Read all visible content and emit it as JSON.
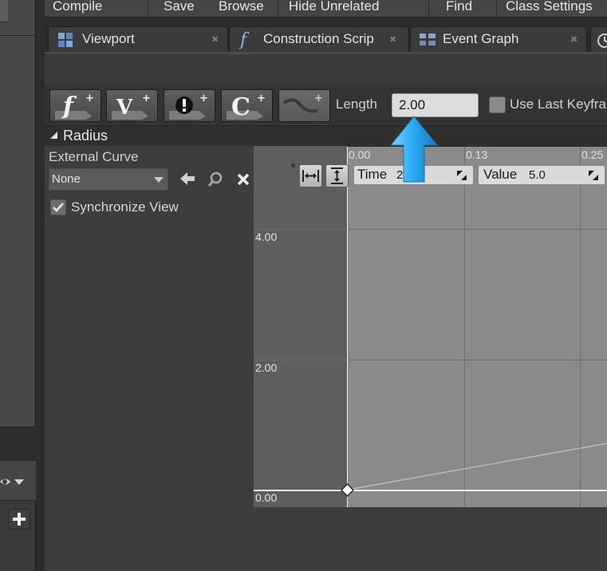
{
  "toolbar": {
    "compile": "Compile",
    "save": "Save",
    "browse": "Browse",
    "hide_unrelated": "Hide Unrelated",
    "find": "Find",
    "class_settings": "Class Settings"
  },
  "tabs": [
    {
      "label": "Viewport",
      "icon": "viewport-icon"
    },
    {
      "label": "Construction Scrip",
      "icon": "function-icon"
    },
    {
      "label": "Event Graph",
      "icon": "graph-icon"
    }
  ],
  "timeline_toolbar": {
    "buttons": [
      "add-float-track-icon",
      "add-vector-track-icon",
      "add-event-track-icon",
      "add-color-track-icon",
      "add-curve-asset-icon"
    ],
    "length_label": "Length",
    "length_value": "2.00",
    "use_last_keyframe_label": "Use Last Keyfra",
    "use_last_keyframe_checked": false
  },
  "track": {
    "name": "Radius",
    "external_curve_label": "External Curve",
    "external_curve_value": "None",
    "synchronize_view_label": "Synchronize View",
    "synchronize_view_checked": true
  },
  "curve_editor": {
    "time_label": "Time",
    "time_value": "2",
    "value_label": "Value",
    "value_value": "5.0",
    "x_ticks": [
      "0.00",
      "0.13",
      "0.25"
    ],
    "y_ticks": [
      "4.00",
      "2.00",
      "0.00"
    ]
  },
  "annotation": {
    "arrow_color": "#29a8f0"
  }
}
